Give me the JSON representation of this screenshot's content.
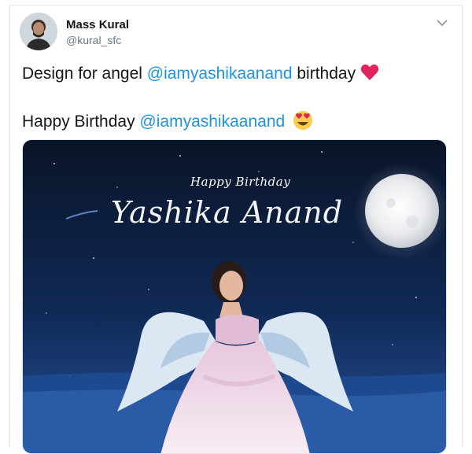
{
  "tweet": {
    "display_name": "Mass Kural",
    "handle": "@kural_sfc",
    "line1_prefix": "Design for angel ",
    "line1_mention": "@iamyashikaanand",
    "line1_suffix": "  birthday",
    "line1_emoji": "heart-icon",
    "line2_prefix": "Happy Birthday ",
    "line2_mention": "@iamyashikaanand",
    "line2_emoji": "heart-eyes-icon"
  },
  "image": {
    "subtitle": "Happy Birthday",
    "title": "Yashika Anand"
  },
  "colors": {
    "mention": "#1b95e0",
    "heart": "#e0245e",
    "night_sky": "#0b1d3d"
  }
}
